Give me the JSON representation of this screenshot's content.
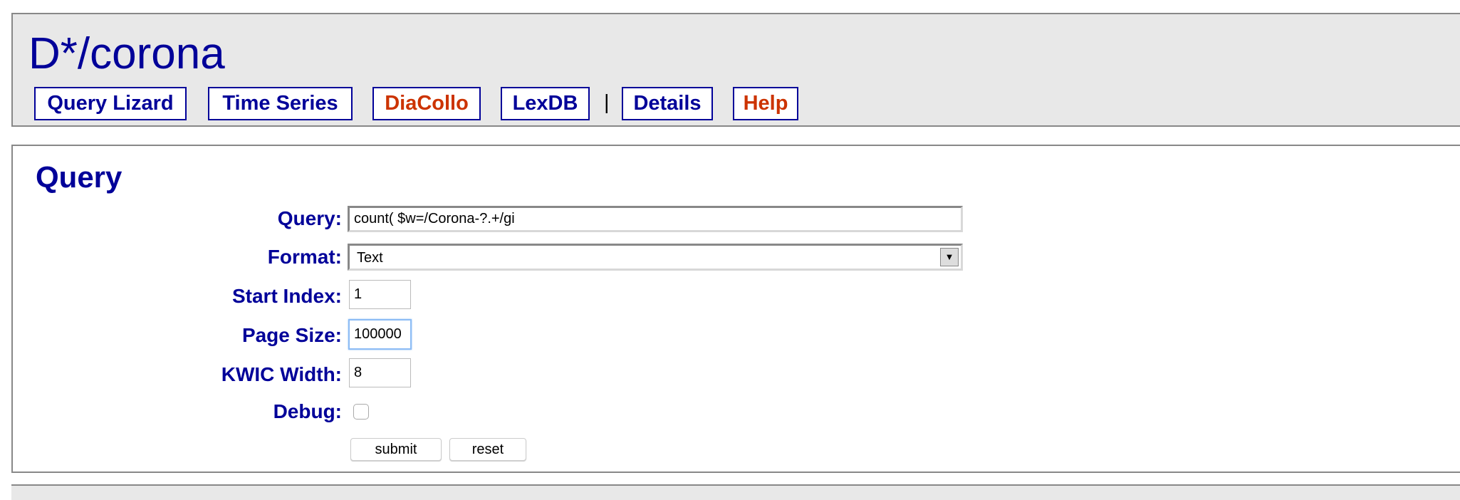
{
  "header": {
    "title": "D*/corona",
    "nav": [
      {
        "label": "Query Lizard"
      },
      {
        "label": "Time Series"
      },
      {
        "label": "DiaCollo"
      },
      {
        "label": "LexDB"
      },
      {
        "label": "Details"
      },
      {
        "label": "Help"
      }
    ],
    "separator": "|"
  },
  "query_form": {
    "heading": "Query",
    "query_label": "Query:",
    "query_value": "count( $w=/Corona-?.+/gi",
    "format_label": "Format:",
    "format_value": "Text",
    "start_index_label": "Start Index:",
    "start_index_value": "1",
    "page_size_label": "Page Size:",
    "page_size_value": "100000",
    "kwic_width_label": "KWIC Width:",
    "kwic_width_value": "8",
    "debug_label": "Debug:",
    "debug_checked": false,
    "submit_label": "submit",
    "reset_label": "reset"
  },
  "colors": {
    "link": "#000099",
    "accent": "#cc3300",
    "header_bg": "#e8e8e8"
  }
}
